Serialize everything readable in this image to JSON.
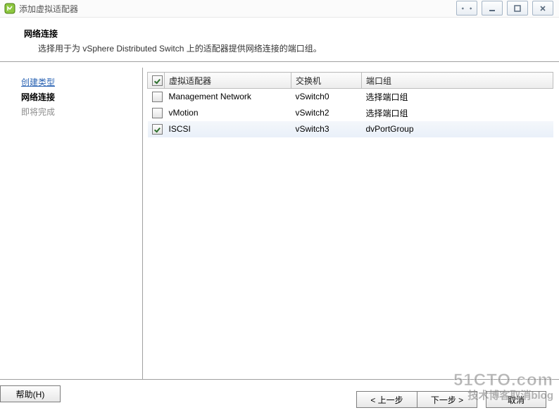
{
  "titlebar": {
    "title": "添加虚拟适配器"
  },
  "header": {
    "title": "网络连接",
    "subtitle": "选择用于为 vSphere Distributed Switch 上的适配器提供网络连接的端口组。"
  },
  "sidebar": {
    "steps": [
      {
        "label": "创建类型",
        "state": "link"
      },
      {
        "label": "网络连接",
        "state": "current"
      },
      {
        "label": "即将完成",
        "state": "disabled"
      }
    ]
  },
  "table": {
    "columns": {
      "adapter": "虚拟适配器",
      "switch": "交换机",
      "portgroup": "端口组"
    },
    "masterChecked": true,
    "rows": [
      {
        "checked": false,
        "adapter": "Management Network",
        "switch": "vSwitch0",
        "portgroup": "选择端口组",
        "selected": false
      },
      {
        "checked": false,
        "adapter": "vMotion",
        "switch": "vSwitch2",
        "portgroup": "选择端口组",
        "selected": false
      },
      {
        "checked": true,
        "adapter": "ISCSI",
        "switch": "vSwitch3",
        "portgroup": "dvPortGroup",
        "selected": true
      }
    ]
  },
  "buttons": {
    "help": "帮助(H)",
    "back": "< 上一步",
    "next": "下一步 >",
    "cancel": "取消"
  },
  "watermark": {
    "line1": "51CTO.com",
    "line2": "技术博客取消blog"
  }
}
